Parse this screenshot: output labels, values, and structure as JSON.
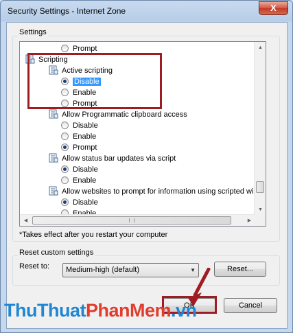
{
  "window": {
    "title": "Security Settings - Internet Zone",
    "close_label": "X"
  },
  "settings_group": {
    "label": "Settings"
  },
  "tree": [
    {
      "kind": "radio",
      "label": "Prompt",
      "indent": 1,
      "checked": false
    },
    {
      "kind": "category",
      "label": "Scripting",
      "indent": 0
    },
    {
      "kind": "category",
      "label": "Active scripting",
      "indent": 1
    },
    {
      "kind": "radio",
      "label": "Disable",
      "indent": 1,
      "checked": true,
      "selected": true
    },
    {
      "kind": "radio",
      "label": "Enable",
      "indent": 1,
      "checked": false
    },
    {
      "kind": "radio",
      "label": "Prompt",
      "indent": 1,
      "checked": false
    },
    {
      "kind": "category",
      "label": "Allow Programmatic clipboard access",
      "indent": 1
    },
    {
      "kind": "radio",
      "label": "Disable",
      "indent": 1,
      "checked": false
    },
    {
      "kind": "radio",
      "label": "Enable",
      "indent": 1,
      "checked": false
    },
    {
      "kind": "radio",
      "label": "Prompt",
      "indent": 1,
      "checked": true
    },
    {
      "kind": "category",
      "label": "Allow status bar updates via script",
      "indent": 1
    },
    {
      "kind": "radio",
      "label": "Disable",
      "indent": 1,
      "checked": true
    },
    {
      "kind": "radio",
      "label": "Enable",
      "indent": 1,
      "checked": false
    },
    {
      "kind": "category",
      "label": "Allow websites to prompt for information using scripted windo",
      "indent": 1
    },
    {
      "kind": "radio",
      "label": "Disable",
      "indent": 1,
      "checked": true
    },
    {
      "kind": "radio",
      "label": "Enable",
      "indent": 1,
      "checked": false
    }
  ],
  "note": "*Takes effect after you restart your computer",
  "reset_group": {
    "label": "Reset custom settings",
    "reset_to_label": "Reset to:",
    "selected_level": "Medium-high (default)",
    "reset_button": "Reset..."
  },
  "footer": {
    "ok_button": "OK",
    "cancel_button": "Cancel"
  },
  "watermark": {
    "part1": "ThuThuat",
    "part2": "PhanMem",
    "part3": ".vn"
  },
  "colors": {
    "selection": "#3399ff",
    "highlight_box": "#a01c23",
    "watermark_blue": "#1e86d2",
    "watermark_red": "#e03d2c"
  }
}
